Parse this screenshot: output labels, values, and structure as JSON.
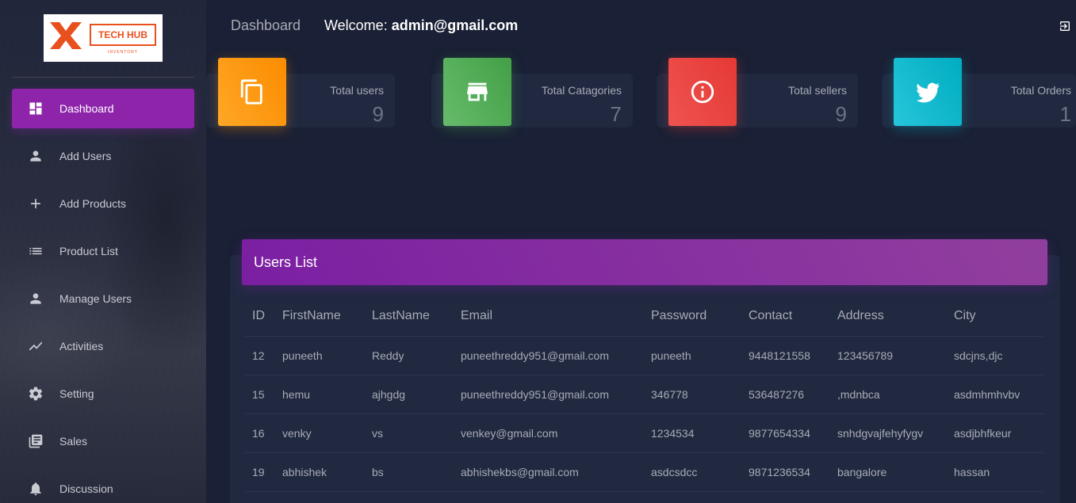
{
  "brand": {
    "logo_text": "TECH HUB",
    "logo_subtext": "INVENTORY",
    "accent": "#e8501e"
  },
  "sidebar": {
    "items": [
      {
        "label": "Dashboard",
        "icon": "dashboard-icon",
        "active": true
      },
      {
        "label": "Add Users",
        "icon": "person-icon"
      },
      {
        "label": "Add Products",
        "icon": "plus-icon"
      },
      {
        "label": "Product List",
        "icon": "list-icon"
      },
      {
        "label": "Manage Users",
        "icon": "person-icon"
      },
      {
        "label": "Activities",
        "icon": "timeline-icon"
      },
      {
        "label": "Setting",
        "icon": "gear-icon"
      },
      {
        "label": "Sales",
        "icon": "library-books-icon"
      },
      {
        "label": "Discussion",
        "icon": "bell-icon"
      }
    ],
    "active_color": "#8e24aa"
  },
  "header": {
    "title": "Dashboard",
    "welcome_prefix": "Welcome:",
    "user_email": "admin@gmail.com",
    "logout_icon": "logout-icon"
  },
  "stats": [
    {
      "label": "Total users",
      "value": "9",
      "icon": "copy-icon",
      "color": "#fb8c00"
    },
    {
      "label": "Total Catagories",
      "value": "7",
      "icon": "store-icon",
      "color": "#43a047"
    },
    {
      "label": "Total sellers",
      "value": "9",
      "icon": "info-icon",
      "color": "#e53935"
    },
    {
      "label": "Total Orders",
      "value": "1",
      "icon": "twitter-icon",
      "color": "#00acc1"
    }
  ],
  "users_list": {
    "title": "Users List",
    "columns": [
      "ID",
      "FirstName",
      "LastName",
      "Email",
      "Password",
      "Contact",
      "Address",
      "City"
    ],
    "rows": [
      [
        "12",
        "puneeth",
        "Reddy",
        "puneethreddy951@gmail.com",
        "puneeth",
        "9448121558",
        "123456789",
        "sdcjns,djc"
      ],
      [
        "15",
        "hemu",
        "ajhgdg",
        "puneethreddy951@gmail.com",
        "346778",
        "536487276",
        ",mdnbca",
        "asdmhmhvbv"
      ],
      [
        "16",
        "venky",
        "vs",
        "venkey@gmail.com",
        "1234534",
        "9877654334",
        "snhdgvajfehyfygv",
        "asdjbhfkeur"
      ],
      [
        "19",
        "abhishek",
        "bs",
        "abhishekbs@gmail.com",
        "asdcsdcc",
        "9871236534",
        "bangalore",
        "hassan"
      ]
    ]
  }
}
